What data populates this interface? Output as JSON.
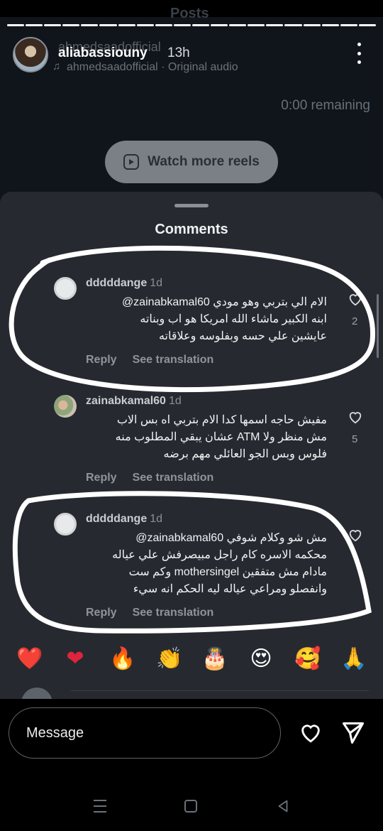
{
  "story": {
    "posts_hint": "Posts",
    "username": "aliabassiouny",
    "ghost_handle": "ahmedsaadofficial",
    "time": "13h",
    "audio_label": "ahmedsaadofficial · Original audio",
    "remaining": "0:00 remaining",
    "watch_more": "Watch more reels",
    "progress_segments": 20
  },
  "comments_sheet": {
    "title": "Comments",
    "comments": [
      {
        "user": "dddddange",
        "time": "1d",
        "mention": "@zainabkamal60",
        "line1": "الام الي بتربي وهو مودي",
        "line2": "ابنه الكبير ماشاء الله امريكا هو اب وبناته",
        "line3": "عايشين علي حسه وبفلوسه وعلاقاته",
        "likes": "2",
        "reply": "Reply",
        "translate": "See translation"
      },
      {
        "user": "zainabkamal60",
        "time": "1d",
        "line1": "مفيش حاجه اسمها كدا الام بتربي اه بس الاب",
        "line2": "مش منظر ولا ATM عشان يبقي المطلوب منه",
        "line3": "فلوس وبس الجو العائلي مهم برضه",
        "likes": "5",
        "reply": "Reply",
        "translate": "See translation"
      },
      {
        "user": "dddddange",
        "time": "1d",
        "mention": "@zainabkamal60",
        "line1": "مش شو وكلام شوفي",
        "line2": "محكمه الاسره كام راجل مبيصرفش علي عياله",
        "line3": "مادام مش متفقين mothersingel وكم ست",
        "line4": "وانفصلو ومراعي عياله ليه الحكم انه سيء",
        "reply": "Reply",
        "translate": "See translation"
      }
    ]
  },
  "emoji_bar": [
    "❤️",
    "❤",
    "🔥",
    "👏",
    "🎂",
    "😍",
    "🥰",
    "🙏"
  ],
  "composer": {
    "placeholder": "Message"
  },
  "colors": {
    "sheet_bg": "#262a30",
    "annotation_stroke": "#ffffff",
    "heart_red": "#e0243c"
  }
}
